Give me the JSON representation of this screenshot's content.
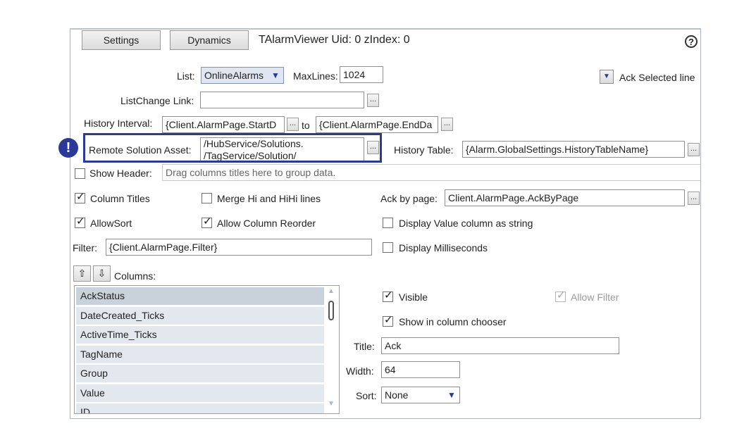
{
  "header": {
    "settings_tab": "Settings",
    "dynamics_tab": "Dynamics",
    "title": "TAlarmViewer Uid: 0 zIndex: 0",
    "help_icon": "?"
  },
  "list_row": {
    "list_label": "List:",
    "list_value": "OnlineAlarms",
    "maxlines_label": "MaxLines:",
    "maxlines_value": "1024",
    "ack_selected_label": "Ack Selected line"
  },
  "listchange": {
    "label": "ListChange Link:",
    "value": "",
    "browse": "..."
  },
  "history_interval": {
    "label": "History Interval:",
    "start_value": "{Client.AlarmPage.StartD",
    "to_label": "to",
    "end_value": "{Client.AlarmPage.EndDa",
    "browse": "..."
  },
  "remote_solution": {
    "label": "Remote Solution Asset:",
    "value": "/HubService/Solutions.",
    "value_line2": "/TagService/Solution/",
    "browse": "...",
    "marker": "!"
  },
  "history_table": {
    "label": "History Table:",
    "value": "{Alarm.GlobalSettings.HistoryTableName}",
    "browse": "..."
  },
  "show_header": {
    "label": "Show Header:",
    "placeholder": "Drag columns titles here to group data.",
    "checked": false
  },
  "options": {
    "column_titles": "Column Titles",
    "merge_hi": "Merge Hi and HiHi lines",
    "ack_by_page_label": "Ack by page:",
    "ack_by_page_value": "Client.AlarmPage.AckByPage",
    "allow_sort": "AllowSort",
    "allow_reorder": "Allow Column Reorder",
    "display_value_string": "Display Value column as string",
    "filter_label": "Filter:",
    "filter_value": "{Client.AlarmPage.Filter}",
    "display_ms": "Display Milliseconds",
    "check_mark": "✓"
  },
  "columns": {
    "label": "Columns:",
    "up_arrow": "⇧",
    "down_arrow": "⇩",
    "items": [
      "AckStatus",
      "DateCreated_Ticks",
      "ActiveTime_Ticks",
      "TagName",
      "Group",
      "Value",
      "ID"
    ]
  },
  "column_props": {
    "visible": "Visible",
    "allow_filter": "Allow Filter",
    "show_in_chooser": "Show in column chooser",
    "title_label": "Title:",
    "title_value": "Ack",
    "width_label": "Width:",
    "width_value": "64",
    "sort_label": "Sort:",
    "sort_value": "None"
  },
  "colors": {
    "accent": "#2b3a99",
    "list_selected": "#c9d1db",
    "list_row": "#e3e8ee"
  }
}
